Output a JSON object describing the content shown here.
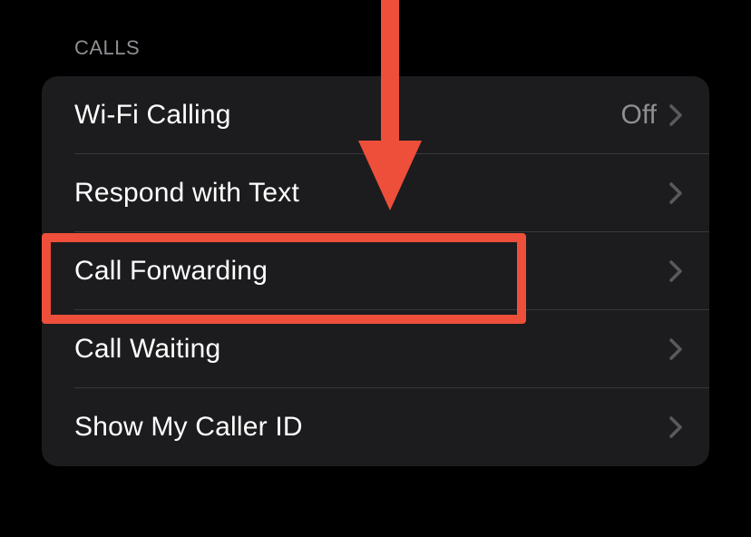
{
  "section": {
    "header": "CALLS",
    "rows": {
      "wifi_calling": {
        "label": "Wi-Fi Calling",
        "value": "Off"
      },
      "respond_with_text": {
        "label": "Respond with Text"
      },
      "call_forwarding": {
        "label": "Call Forwarding"
      },
      "call_waiting": {
        "label": "Call Waiting"
      },
      "show_my_caller_id": {
        "label": "Show My Caller ID"
      }
    }
  },
  "annotations": {
    "highlight_color": "#ee4f3a",
    "arrow_color": "#ee4f3a"
  }
}
